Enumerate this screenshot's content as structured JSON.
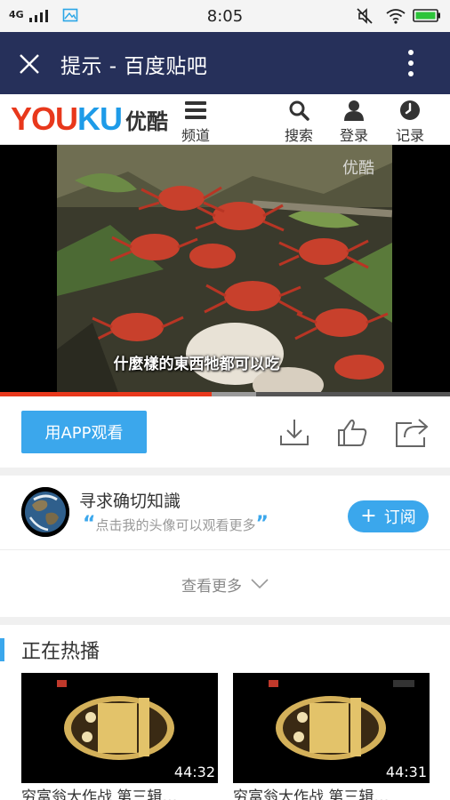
{
  "status_bar": {
    "network": "4G",
    "time": "8:05"
  },
  "title_bar": {
    "title": "提示 - 百度贴吧"
  },
  "youku": {
    "logo_en": "YOUKU",
    "logo_cn": "优酷",
    "nav": {
      "channels": "频道",
      "search": "搜索",
      "login": "登录",
      "history": "记录"
    }
  },
  "video": {
    "watermark": "优酷",
    "subtitle": "什麼樣的東西牠都可以吃",
    "progress_fraction": 0.47,
    "buffered_fraction": 0.57
  },
  "actions": {
    "app_button": "用APP观看"
  },
  "channel": {
    "name": "寻求确切知識",
    "hint": "点击我的头像可以观看更多",
    "subscribe": "订阅"
  },
  "see_more": "查看更多",
  "hot": {
    "title": "正在热播",
    "items": [
      {
        "duration": "44:32",
        "title": "穷富翁大作战 第三辑…"
      },
      {
        "duration": "44:31",
        "title": "穷富翁大作战 第三辑…"
      }
    ]
  },
  "colors": {
    "title_bar": "#26305a",
    "accent_blue": "#3ba7ec",
    "youku_red": "#e8381c",
    "progress_red": "#e8381c"
  }
}
